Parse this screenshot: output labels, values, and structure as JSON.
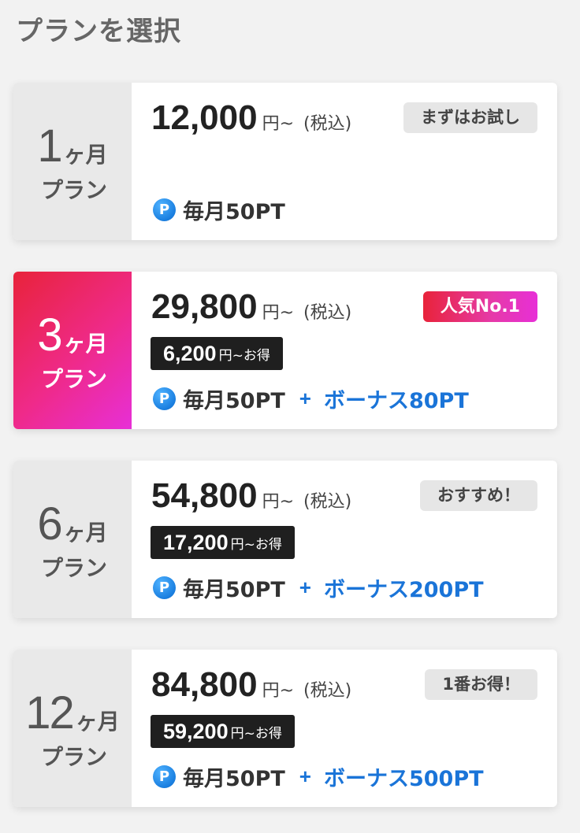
{
  "page": {
    "title": "プランを選択"
  },
  "plans": [
    {
      "months": "1",
      "months_unit": "ヶ月",
      "label": "プラン",
      "price": "12,000",
      "price_unit": "円~",
      "tax": "(税込)",
      "badge": "まずはお試し",
      "savings": "",
      "savings_suffix": "",
      "points": "毎月50PT",
      "plus": "",
      "bonus": ""
    },
    {
      "months": "3",
      "months_unit": "ヶ月",
      "label": "プラン",
      "price": "29,800",
      "price_unit": "円~",
      "tax": "(税込)",
      "badge": "人気No.1",
      "savings": "6,200",
      "savings_suffix": "円~お得",
      "points": "毎月50PT",
      "plus": "+",
      "bonus": "ボーナス80PT"
    },
    {
      "months": "6",
      "months_unit": "ヶ月",
      "label": "プラン",
      "price": "54,800",
      "price_unit": "円~",
      "tax": "(税込)",
      "badge": "おすすめ！",
      "savings": "17,200",
      "savings_suffix": "円~お得",
      "points": "毎月50PT",
      "plus": "+",
      "bonus": "ボーナス200PT"
    },
    {
      "months": "12",
      "months_unit": "ヶ月",
      "label": "プラン",
      "price": "84,800",
      "price_unit": "円~",
      "tax": "(税込)",
      "badge": "1番お得！",
      "savings": "59,200",
      "savings_suffix": "円~お得",
      "points": "毎月50PT",
      "plus": "+",
      "bonus": "ボーナス500PT"
    }
  ],
  "icons": {
    "points_icon": "points-p-icon",
    "points_letter": "P"
  },
  "colors": {
    "featured_gradient_start": "#e8233a",
    "featured_gradient_end": "#e72fd7",
    "bonus_blue": "#1a74d8",
    "savings_bg": "#1f1f1f"
  }
}
